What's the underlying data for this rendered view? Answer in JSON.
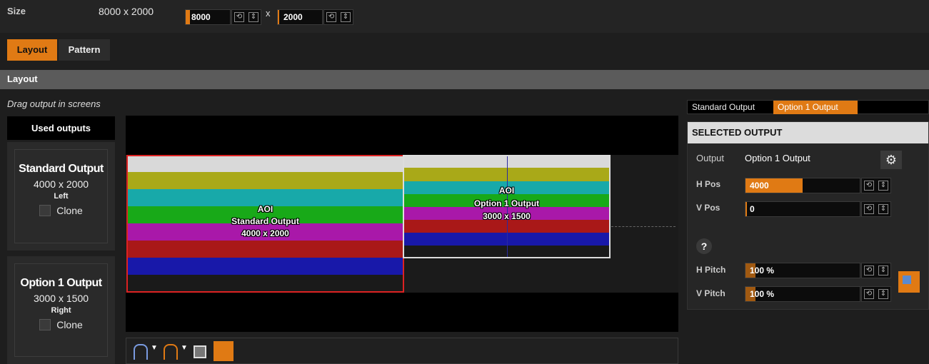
{
  "top": {
    "size_label": "Size",
    "size_value": "8000 x 2000",
    "width_value": "8000",
    "x_sep": "x",
    "height_value": "2000"
  },
  "tabs": {
    "layout": "Layout",
    "pattern": "Pattern"
  },
  "section": {
    "title": "Layout"
  },
  "hint": "Drag output in screens",
  "used_outputs_tab": "Used outputs",
  "outputs": [
    {
      "name": "Standard Output",
      "size": "4000 x 2000",
      "side": "Left",
      "clone_label": "Clone"
    },
    {
      "name": "Option 1 Output",
      "size": "3000 x 1500",
      "side": "Right",
      "clone_label": "Clone"
    }
  ],
  "canvas": {
    "screen1": {
      "line1": "AOI",
      "line2": "Standard Output",
      "line3": "4000 x 2000"
    },
    "screen2": {
      "line1": "AOI",
      "line2": "Option 1 Output",
      "line3": "3000 x 1500"
    }
  },
  "right_panel": {
    "tabs": [
      "Standard Output",
      "Option 1 Output"
    ],
    "header": "SELECTED OUTPUT",
    "output_label": "Output",
    "output_value": "Option 1 Output",
    "hpos_label": "H Pos",
    "hpos_value": "4000",
    "vpos_label": "V Pos",
    "vpos_value": "0",
    "help": "?",
    "hpitch_label": "H Pitch",
    "hpitch_value": "100 %",
    "vpitch_label": "V Pitch",
    "vpitch_value": "100 %"
  },
  "colors": {
    "accent": "#e07a14",
    "pattern": [
      "#d9d9d9",
      "#a9a918",
      "#18a9a9",
      "#18a918",
      "#a918a9",
      "#a91818",
      "#1818a9",
      "#1a1a1a"
    ]
  }
}
